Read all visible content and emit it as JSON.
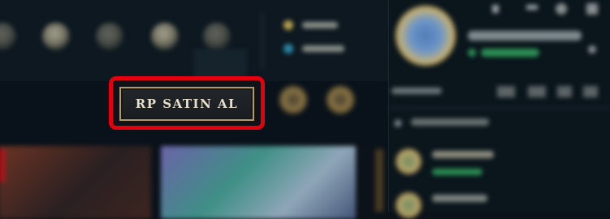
{
  "store": {
    "buy_rp_label": "RP SATIN AL"
  },
  "colors": {
    "highlight": "#e5000d",
    "button_border": "#b39a5f",
    "button_text": "#e7dfc9",
    "online_status": "#2b8f54"
  },
  "icons": {
    "nav": [
      "home-icon",
      "collection-icon",
      "loot-icon",
      "shop-icon",
      "store-icon"
    ],
    "currency": [
      "blue-essence-icon",
      "riot-points-icon"
    ],
    "social": [
      "settings-icon",
      "friends-icon",
      "chat-icon"
    ]
  }
}
